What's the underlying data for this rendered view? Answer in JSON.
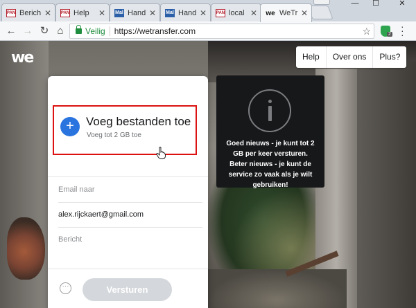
{
  "browser": {
    "tabs": [
      {
        "label": "Berich",
        "favicon": "PAN",
        "icon": "pan-favicon"
      },
      {
        "label": "Help",
        "favicon": "PAN",
        "icon": "pan-favicon"
      },
      {
        "label": "Hand",
        "favicon": "Mal",
        "icon": "blue-favicon"
      },
      {
        "label": "Hand",
        "favicon": "Mal",
        "icon": "blue-favicon"
      },
      {
        "label": "local",
        "favicon": "PAN",
        "icon": "pan-favicon"
      },
      {
        "label": "WeTr",
        "favicon": "we",
        "icon": "wetransfer-favicon",
        "active": true
      }
    ],
    "tab_close": "✕",
    "window_controls": {
      "minimize": "—",
      "maximize": "☐",
      "close": "✕"
    },
    "nav": {
      "back": "←",
      "forward": "→",
      "reload": "↻",
      "home": "⌂"
    },
    "security_label": "Veilig",
    "url": "https://wetransfer.com",
    "bookmark_star": "☆",
    "extension_badge": "2"
  },
  "site": {
    "logo": "we",
    "topnav": [
      "Help",
      "Over ons",
      "Plus?"
    ]
  },
  "upload": {
    "plus_symbol": "+",
    "title": "Voeg bestanden toe",
    "subtitle": "Voeg tot 2 GB toe",
    "email_to_placeholder": "Email naar",
    "email_from_value": "alex.rijckaert@gmail.com",
    "message_placeholder": "Bericht",
    "more_symbol": "···",
    "send_label": "Versturen"
  },
  "tooltip": {
    "text": "Goed nieuws - je kunt tot 2 GB per keer versturen. Beter nieuws - je kunt de service zo vaak als je wilt gebruiken!"
  },
  "colors": {
    "accent_blue": "#2a74df",
    "highlight_red": "#dd1111",
    "secure_green": "#1e8e3e"
  }
}
